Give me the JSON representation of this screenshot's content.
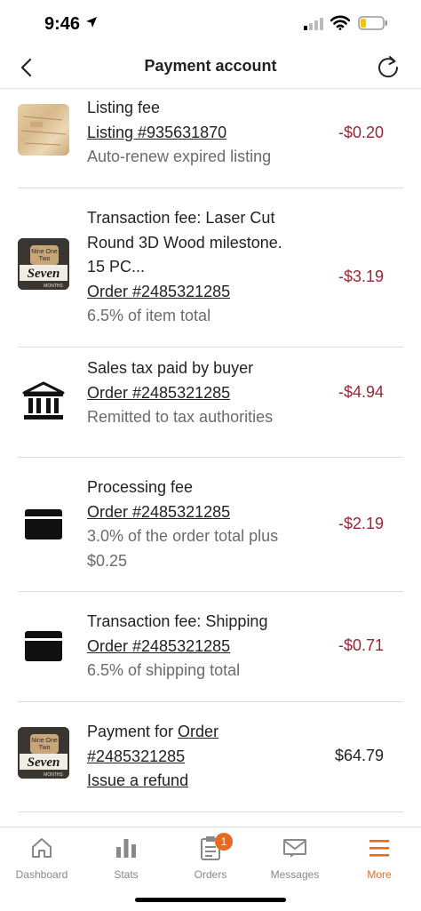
{
  "status": {
    "time": "9:46"
  },
  "nav": {
    "title": "Payment account"
  },
  "rows": [
    {
      "title": "Listing fee",
      "link": "Listing #935631870",
      "subs": [
        "Auto-renew expired listing"
      ],
      "amount": "-$0.20"
    },
    {
      "title_lines": [
        "Transaction fee: Laser Cut",
        "Round 3D Wood milestone.",
        "15 PC..."
      ],
      "link": "Order #2485321285",
      "subs": [
        "6.5% of item total"
      ],
      "amount": "-$3.19"
    },
    {
      "title": "Sales tax paid by buyer",
      "link": "Order #2485321285",
      "subs": [
        "Remitted to tax authorities"
      ],
      "amount": "-$4.94"
    },
    {
      "title": "Processing fee",
      "link": "Order #2485321285",
      "subs": [
        "3.0% of the order total plus",
        "$0.25"
      ],
      "amount": "-$2.19"
    },
    {
      "title": "Transaction fee: Shipping",
      "link": "Order #2485321285",
      "subs": [
        "6.5% of shipping total"
      ],
      "amount": "-$0.71"
    },
    {
      "title_prefix": "Payment for ",
      "link_a": "Order",
      "link_b": "#2485321285",
      "refund": "Issue a refund",
      "amount": "$64.79"
    }
  ],
  "icons": {
    "row1": "wood-listing-thumbnail",
    "row2": "wood-milestone-thumbnail",
    "row3": "bank-icon",
    "row4": "card-icon",
    "row5": "card-icon",
    "row6": "wood-milestone-thumbnail"
  },
  "thumb_text": {
    "line1": "Nine One",
    "line2": "Two",
    "line3": "Seven",
    "line4": "MONTHS"
  },
  "tabs": [
    {
      "label": "Dashboard",
      "icon": "home-icon"
    },
    {
      "label": "Stats",
      "icon": "bar-chart-icon"
    },
    {
      "label": "Orders",
      "icon": "clipboard-icon",
      "badge": "1"
    },
    {
      "label": "Messages",
      "icon": "mail-icon"
    },
    {
      "label": "More",
      "icon": "menu-icon"
    }
  ],
  "colors": {
    "accent": "#e86a1f",
    "negative": "#9b2335",
    "muted": "#6b6b6b"
  }
}
